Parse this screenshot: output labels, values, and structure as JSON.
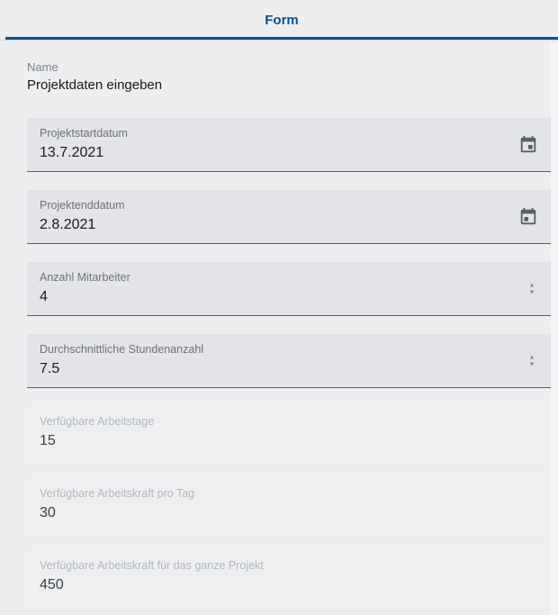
{
  "tabs": {
    "form": "Form"
  },
  "name": {
    "label": "Name",
    "value": "Projektdaten eingeben"
  },
  "fields": {
    "start_date": {
      "label": "Projektstartdatum",
      "value": "13.7.2021"
    },
    "end_date": {
      "label": "Projektenddatum",
      "value": "2.8.2021"
    },
    "employee_count": {
      "label": "Anzahl Mitarbeiter",
      "value": "4"
    },
    "avg_hours": {
      "label": "Durchschnittliche Stundenanzahl",
      "value": "7.5"
    },
    "available_days": {
      "label": "Verfügbare Arbeitstage",
      "value": "15"
    },
    "capacity_per_day": {
      "label": "Verfügbare Arbeitskraft pro Tag",
      "value": "30"
    },
    "capacity_total": {
      "label": "Verfügbare Arbeitskraft für das ganze Projekt",
      "value": "450"
    }
  }
}
